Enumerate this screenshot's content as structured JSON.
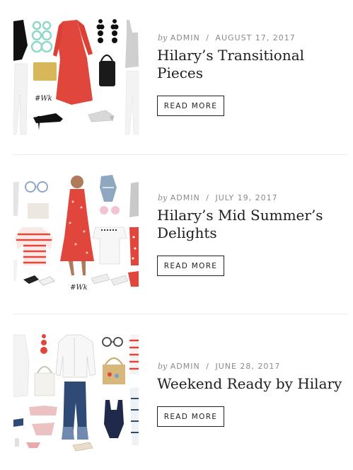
{
  "posts": [
    {
      "author_prefix": "by",
      "author": "ADMIN",
      "separator": "/",
      "date": "AUGUST 17, 2017",
      "title": "Hilary’s Transitional Pieces",
      "button_label": "READ MORE",
      "logo_text": "#Wk"
    },
    {
      "author_prefix": "by",
      "author": "ADMIN",
      "separator": "/",
      "date": "JULY 19, 2017",
      "title": "Hilary’s Mid Summer’s Delights",
      "button_label": "READ MORE",
      "logo_text": "#Wk"
    },
    {
      "author_prefix": "by",
      "author": "ADMIN",
      "separator": "/",
      "date": "JUNE 28, 2017",
      "title": "Weekend Ready by Hilary",
      "button_label": "READ MORE"
    }
  ],
  "colors": {
    "title": "#1e1e1e",
    "meta": "#8a8a8a",
    "divider": "#ececec",
    "accent_red": "#e0463b"
  }
}
